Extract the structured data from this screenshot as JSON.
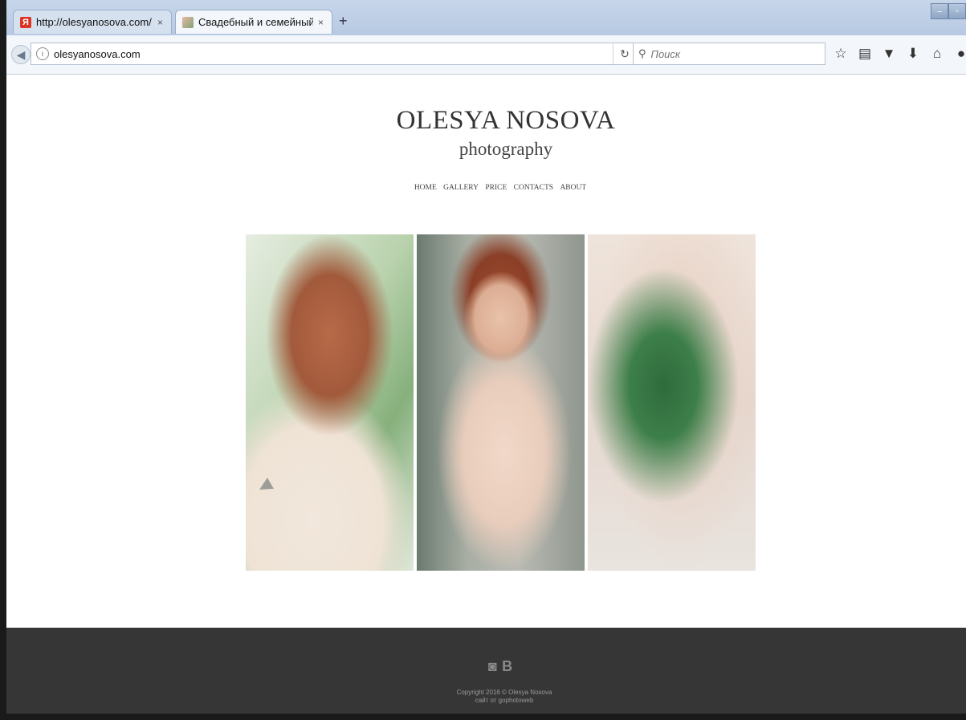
{
  "browser": {
    "tabs": [
      {
        "title": "http://olesyanosova.com/ ...",
        "favicon": "yandex-icon",
        "close": "×"
      },
      {
        "title": "Свадебный и семейный ...",
        "favicon": "photo-icon",
        "close": "×"
      }
    ],
    "new_tab": "+",
    "address": "olesyanosova.com",
    "search_placeholder": "Поиск"
  },
  "site": {
    "title": "OLESYA NOSOVA",
    "subtitle": "photography",
    "menu": [
      "HOME",
      "GALLERY",
      "PRICE",
      "CONTACTS",
      "ABOUT"
    ]
  },
  "footer": {
    "social": [
      "instagram-icon",
      "vk-icon"
    ],
    "copyright": "Copyright 2016 © Olesya Nosova",
    "credit": "сайт от gophotoweb"
  }
}
